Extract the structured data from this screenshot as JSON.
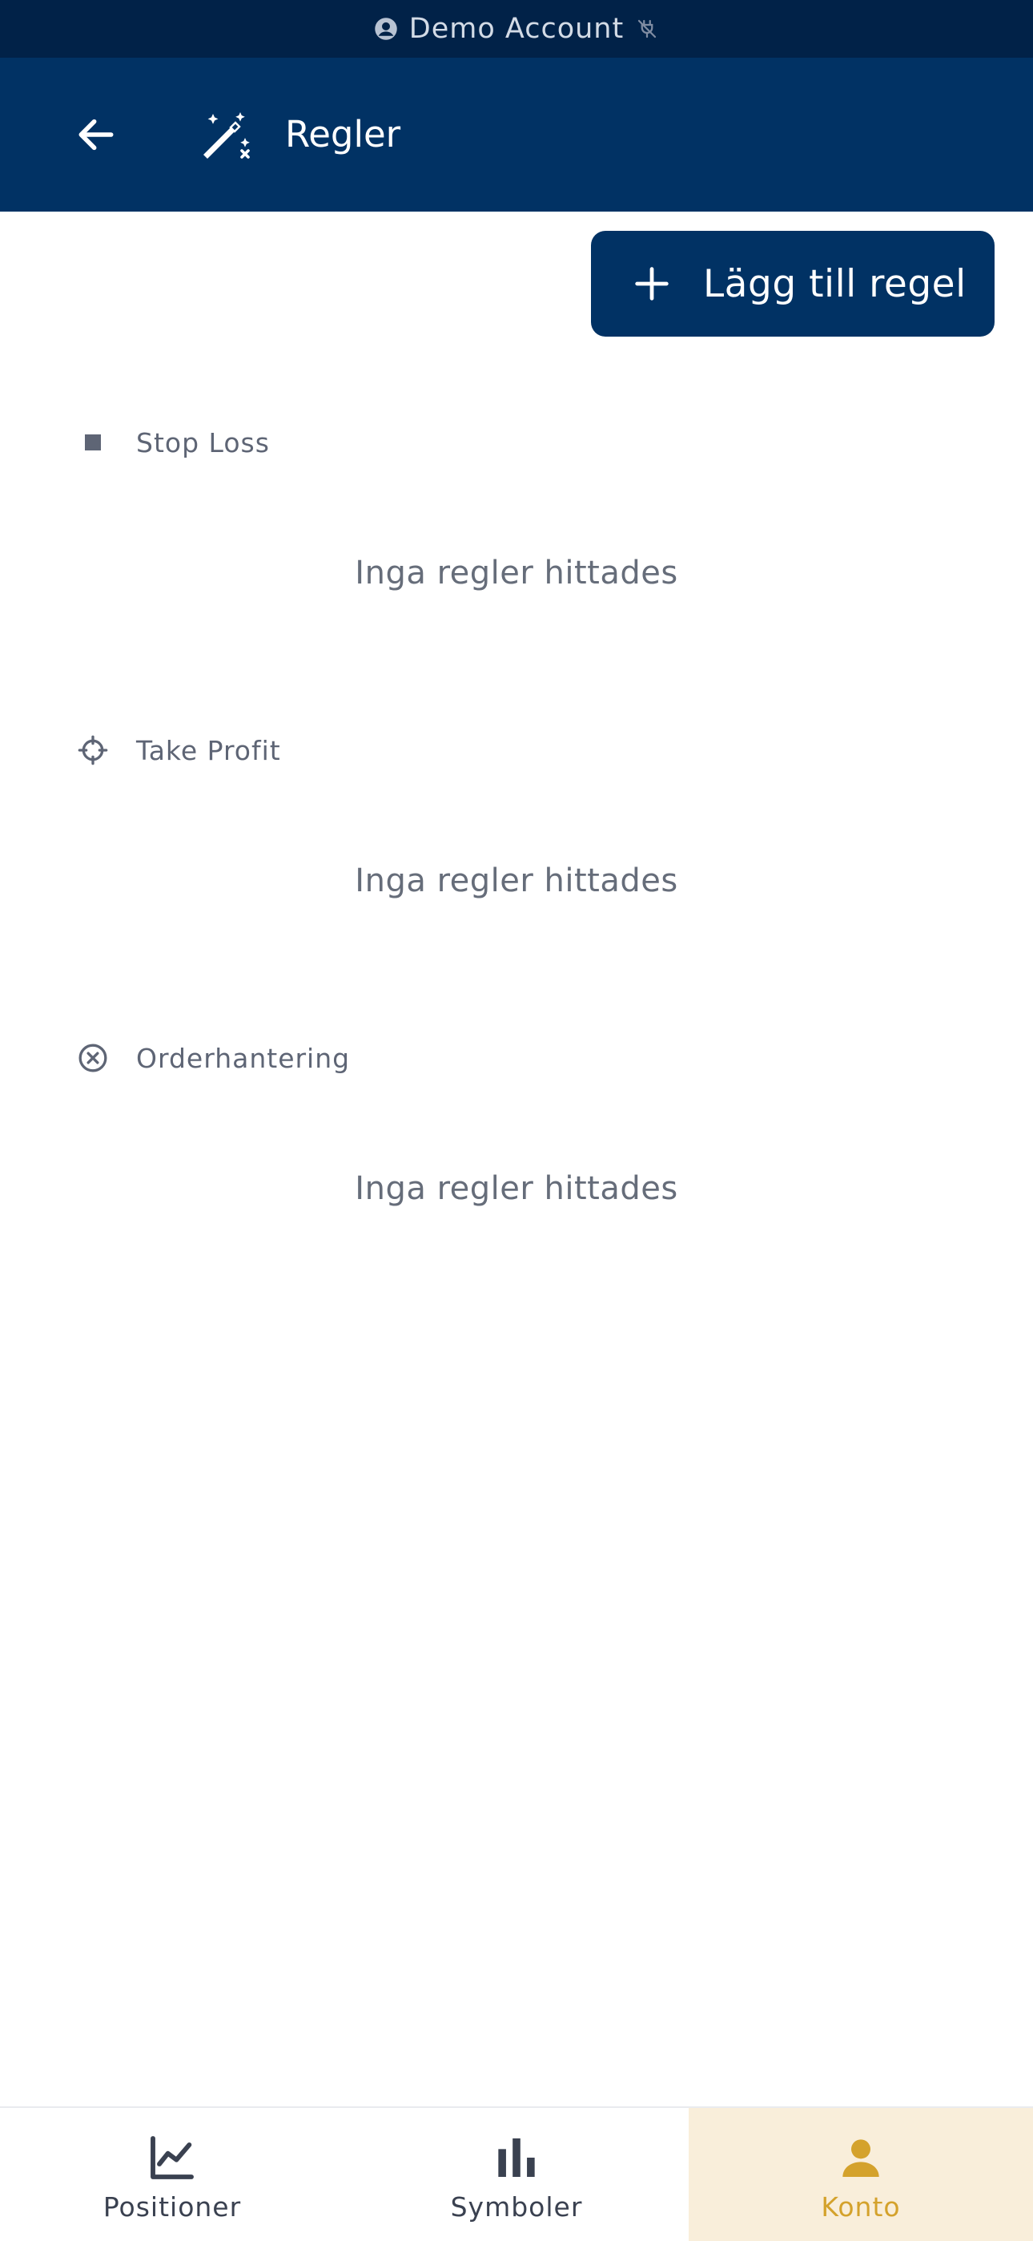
{
  "status_bar": {
    "account_label": "Demo Account"
  },
  "header": {
    "title": "Regler"
  },
  "actions": {
    "add_rule_label": "Lägg till regel"
  },
  "sections": [
    {
      "title": "Stop Loss",
      "icon": "square-icon",
      "empty_text": "Inga regler hittades"
    },
    {
      "title": "Take Profit",
      "icon": "crosshair-icon",
      "empty_text": "Inga regler hittades"
    },
    {
      "title": "Orderhantering",
      "icon": "circle-x-icon",
      "empty_text": "Inga regler hittades"
    }
  ],
  "bottom_nav": {
    "items": [
      {
        "label": "Positioner",
        "icon": "line-chart-icon",
        "active": false
      },
      {
        "label": "Symboler",
        "icon": "bar-chart-icon",
        "active": false
      },
      {
        "label": "Konto",
        "icon": "person-icon",
        "active": true
      }
    ]
  },
  "colors": {
    "status_bar_bg": "#012248",
    "header_bg": "#013264",
    "primary_button": "#013264",
    "active_tab_bg": "#f9eeda",
    "active_tab_text": "#d4a22c"
  }
}
